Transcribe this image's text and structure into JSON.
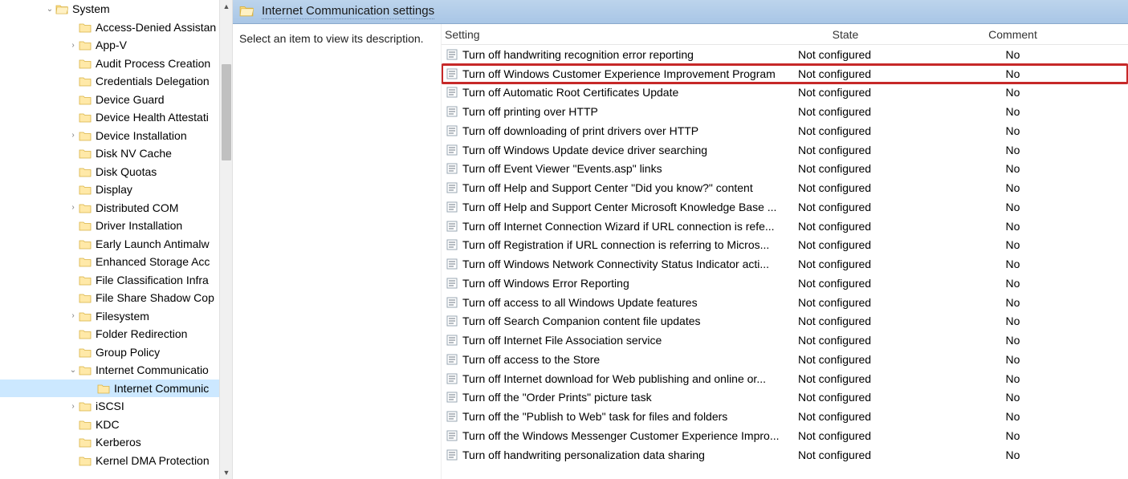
{
  "tree": {
    "root_label": "System",
    "items": [
      {
        "label": "Access-Denied Assistan",
        "expandable": false
      },
      {
        "label": "App-V",
        "expandable": true
      },
      {
        "label": "Audit Process Creation",
        "expandable": false
      },
      {
        "label": "Credentials Delegation",
        "expandable": false
      },
      {
        "label": "Device Guard",
        "expandable": false
      },
      {
        "label": "Device Health Attestati",
        "expandable": false
      },
      {
        "label": "Device Installation",
        "expandable": true
      },
      {
        "label": "Disk NV Cache",
        "expandable": false
      },
      {
        "label": "Disk Quotas",
        "expandable": false
      },
      {
        "label": "Display",
        "expandable": false
      },
      {
        "label": "Distributed COM",
        "expandable": true
      },
      {
        "label": "Driver Installation",
        "expandable": false
      },
      {
        "label": "Early Launch Antimalw",
        "expandable": false
      },
      {
        "label": "Enhanced Storage Acc",
        "expandable": false
      },
      {
        "label": "File Classification Infra",
        "expandable": false
      },
      {
        "label": "File Share Shadow Cop",
        "expandable": false
      },
      {
        "label": "Filesystem",
        "expandable": true
      },
      {
        "label": "Folder Redirection",
        "expandable": false
      },
      {
        "label": "Group Policy",
        "expandable": false
      },
      {
        "label": "Internet Communicatio",
        "expandable": true,
        "expanded": true
      },
      {
        "label": "Internet Communic",
        "expandable": false,
        "child": true,
        "selected": true
      },
      {
        "label": "iSCSI",
        "expandable": true
      },
      {
        "label": "KDC",
        "expandable": false
      },
      {
        "label": "Kerberos",
        "expandable": false
      },
      {
        "label": "Kernel DMA Protection",
        "expandable": false
      }
    ]
  },
  "main": {
    "title": "Internet Communication settings",
    "description_prompt": "Select an item to view its description.",
    "columns": {
      "setting": "Setting",
      "state": "State",
      "comment": "Comment"
    },
    "rows": [
      {
        "setting": "Turn off handwriting recognition error reporting",
        "state": "Not configured",
        "comment": "No"
      },
      {
        "setting": "Turn off Windows Customer Experience Improvement Program",
        "state": "Not configured",
        "comment": "No",
        "highlight": true
      },
      {
        "setting": "Turn off Automatic Root Certificates Update",
        "state": "Not configured",
        "comment": "No"
      },
      {
        "setting": "Turn off printing over HTTP",
        "state": "Not configured",
        "comment": "No"
      },
      {
        "setting": "Turn off downloading of print drivers over HTTP",
        "state": "Not configured",
        "comment": "No"
      },
      {
        "setting": "Turn off Windows Update device driver searching",
        "state": "Not configured",
        "comment": "No"
      },
      {
        "setting": "Turn off Event Viewer \"Events.asp\" links",
        "state": "Not configured",
        "comment": "No"
      },
      {
        "setting": "Turn off Help and Support Center \"Did you know?\" content",
        "state": "Not configured",
        "comment": "No"
      },
      {
        "setting": "Turn off Help and Support Center Microsoft Knowledge Base ...",
        "state": "Not configured",
        "comment": "No"
      },
      {
        "setting": "Turn off Internet Connection Wizard if URL connection is refe...",
        "state": "Not configured",
        "comment": "No"
      },
      {
        "setting": "Turn off Registration if URL connection is referring to Micros...",
        "state": "Not configured",
        "comment": "No"
      },
      {
        "setting": "Turn off Windows Network Connectivity Status Indicator acti...",
        "state": "Not configured",
        "comment": "No"
      },
      {
        "setting": "Turn off Windows Error Reporting",
        "state": "Not configured",
        "comment": "No"
      },
      {
        "setting": "Turn off access to all Windows Update features",
        "state": "Not configured",
        "comment": "No"
      },
      {
        "setting": "Turn off Search Companion content file updates",
        "state": "Not configured",
        "comment": "No"
      },
      {
        "setting": "Turn off Internet File Association service",
        "state": "Not configured",
        "comment": "No"
      },
      {
        "setting": "Turn off access to the Store",
        "state": "Not configured",
        "comment": "No"
      },
      {
        "setting": "Turn off Internet download for Web publishing and online or...",
        "state": "Not configured",
        "comment": "No"
      },
      {
        "setting": "Turn off the \"Order Prints\" picture task",
        "state": "Not configured",
        "comment": "No"
      },
      {
        "setting": "Turn off the \"Publish to Web\" task for files and folders",
        "state": "Not configured",
        "comment": "No"
      },
      {
        "setting": "Turn off the Windows Messenger Customer Experience Impro...",
        "state": "Not configured",
        "comment": "No"
      },
      {
        "setting": "Turn off handwriting personalization data sharing",
        "state": "Not configured",
        "comment": "No"
      }
    ]
  }
}
